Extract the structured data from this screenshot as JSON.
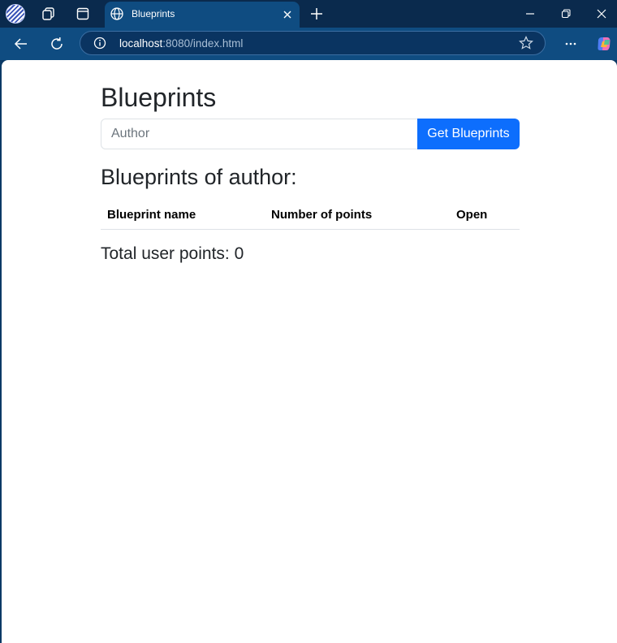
{
  "browser": {
    "tab_title": "Blueprints",
    "url_host": "localhost",
    "url_rest": ":8080/index.html",
    "icons": [
      "profile-avatar",
      "workspaces-icon",
      "tab-actions-icon",
      "globe-icon",
      "close-icon",
      "plus-icon",
      "minimize-icon",
      "restore-icon",
      "close-window-icon",
      "back-arrow-icon",
      "refresh-icon",
      "info-icon",
      "star-icon",
      "more-icon",
      "copilot-icon"
    ]
  },
  "page": {
    "title": "Blueprints",
    "author_placeholder": "Author",
    "author_value": "",
    "get_button_label": "Get Blueprints",
    "subheading": "Blueprints of author:",
    "table": {
      "columns": [
        "Blueprint name",
        "Number of points",
        "Open"
      ],
      "rows": []
    },
    "total_label": "Total user points: 0"
  },
  "colors": {
    "primary_button": "#0d6efd",
    "tab_bar": "#0a2a4d",
    "toolbar": "#0f4c81"
  }
}
